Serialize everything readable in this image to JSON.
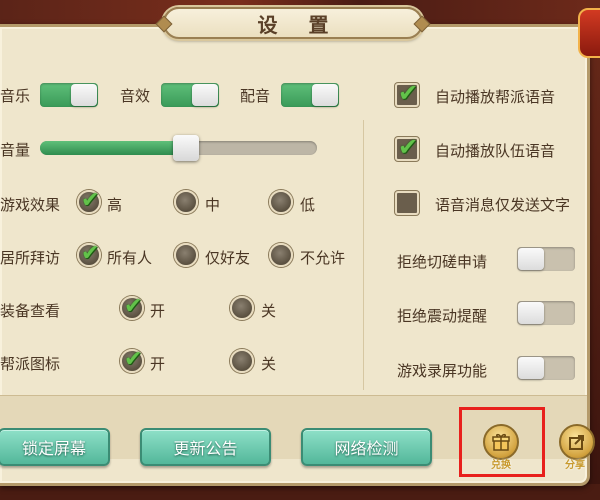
{
  "title": "设 置",
  "audio": {
    "music": {
      "label": "音乐",
      "on": true
    },
    "sfx": {
      "label": "音效",
      "on": true
    },
    "voice": {
      "label": "配音",
      "on": true
    }
  },
  "volume": {
    "label": "音量",
    "level": 0.53
  },
  "game_effect": {
    "label": "游戏效果",
    "options": [
      "高",
      "中",
      "低"
    ],
    "selected": "高"
  },
  "home_visit": {
    "label": "居所拜访",
    "options": [
      "所有人",
      "仅好友",
      "不允许"
    ],
    "selected": "所有人"
  },
  "equip_view": {
    "label": "装备查看",
    "options": [
      "开",
      "关"
    ],
    "selected": "开"
  },
  "guild_icon": {
    "label": "帮派图标",
    "options": [
      "开",
      "关"
    ],
    "selected": "开"
  },
  "right_checks": [
    {
      "label": "自动播放帮派语音",
      "checked": true
    },
    {
      "label": "自动播放队伍语音",
      "checked": true
    },
    {
      "label": "语音消息仅发送文字",
      "checked": false
    }
  ],
  "right_toggles": [
    {
      "label": "拒绝切磋申请",
      "on": false
    },
    {
      "label": "拒绝震动提醒",
      "on": false
    },
    {
      "label": "游戏录屏功能",
      "on": false
    }
  ],
  "bottom_buttons": [
    "锁定屏幕",
    "更新公告",
    "网络检测"
  ],
  "icon_buttons": [
    {
      "icon": "gift-icon",
      "caption": "兑换"
    },
    {
      "icon": "share-icon",
      "caption": "分享"
    }
  ],
  "colors": {
    "accent_green": "#3a9a58",
    "highlight_red": "#e8201c"
  }
}
